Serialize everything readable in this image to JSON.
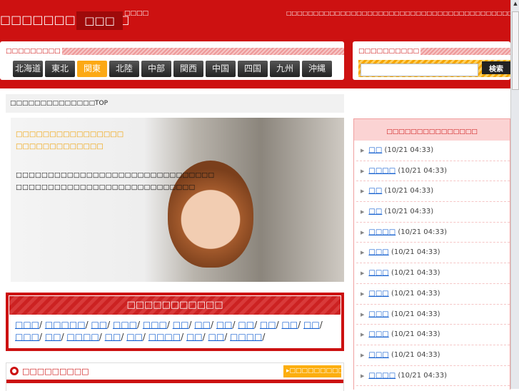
{
  "header": {
    "title": "□□□□□□□□□□□□",
    "badge": "□□□",
    "small": "□□□□",
    "tagline": "□□□□□□□□□□□□□□□□□□□□□□□□□□□□□□□□□□□□□□□□□□□□□"
  },
  "regions": {
    "label": "□□□□□□□□□",
    "items": [
      "北海道",
      "東北",
      "関東",
      "北陸",
      "中部",
      "関西",
      "中国",
      "四国",
      "九州",
      "沖縄"
    ],
    "active": "関東"
  },
  "search": {
    "label": "□□□□□□□□□□",
    "value": "",
    "button": "検索"
  },
  "breadcrumb": "□□□□□□□□□□□□□□TOP",
  "hero": {
    "orange": [
      "□□□□□□□□□□□□□□□□",
      "□□□□□□□□□□□□□"
    ],
    "body": [
      "□□□□□□□□□□□□□□□□□□□□□□□□□□□□□□□",
      "□□□□□□□□□□□□□□□□□□□□□□□□□□□□"
    ]
  },
  "category": {
    "title": "□□□□□□□□□□□",
    "links": [
      "□□□",
      "□□□□□",
      "□□",
      "□□□",
      "□□□",
      "□□",
      "□□",
      "□□",
      "□□",
      "□□",
      "□□",
      "□□",
      "□□□",
      "□□",
      "□□□□",
      "□□",
      "□□",
      "□□□□",
      "□□",
      "□□",
      "□□□□"
    ]
  },
  "section": {
    "title": "□□□□□□□□□",
    "button": "▸□□□□□□□□□□□"
  },
  "sidebar": {
    "title": "□□□□□□□□□□□□□□□",
    "items": [
      {
        "name": "□□",
        "time": "(10/21 04:33)"
      },
      {
        "name": "□□□□",
        "time": "(10/21 04:33)"
      },
      {
        "name": "□□",
        "time": "(10/21 04:33)"
      },
      {
        "name": "□□",
        "time": "(10/21 04:33)"
      },
      {
        "name": "□□□□",
        "time": "(10/21 04:33)"
      },
      {
        "name": "□□□",
        "time": "(10/21 04:33)"
      },
      {
        "name": "□□□",
        "time": "(10/21 04:33)"
      },
      {
        "name": "□□□",
        "time": "(10/21 04:33)"
      },
      {
        "name": "□□□",
        "time": "(10/21 04:33)"
      },
      {
        "name": "□□□",
        "time": "(10/21 04:33)"
      },
      {
        "name": "□□□",
        "time": "(10/21 04:33)"
      },
      {
        "name": "□□□□",
        "time": "(10/21 04:33)"
      }
    ]
  },
  "colors": {
    "brand": "#cd1111",
    "accent": "#fca915"
  }
}
